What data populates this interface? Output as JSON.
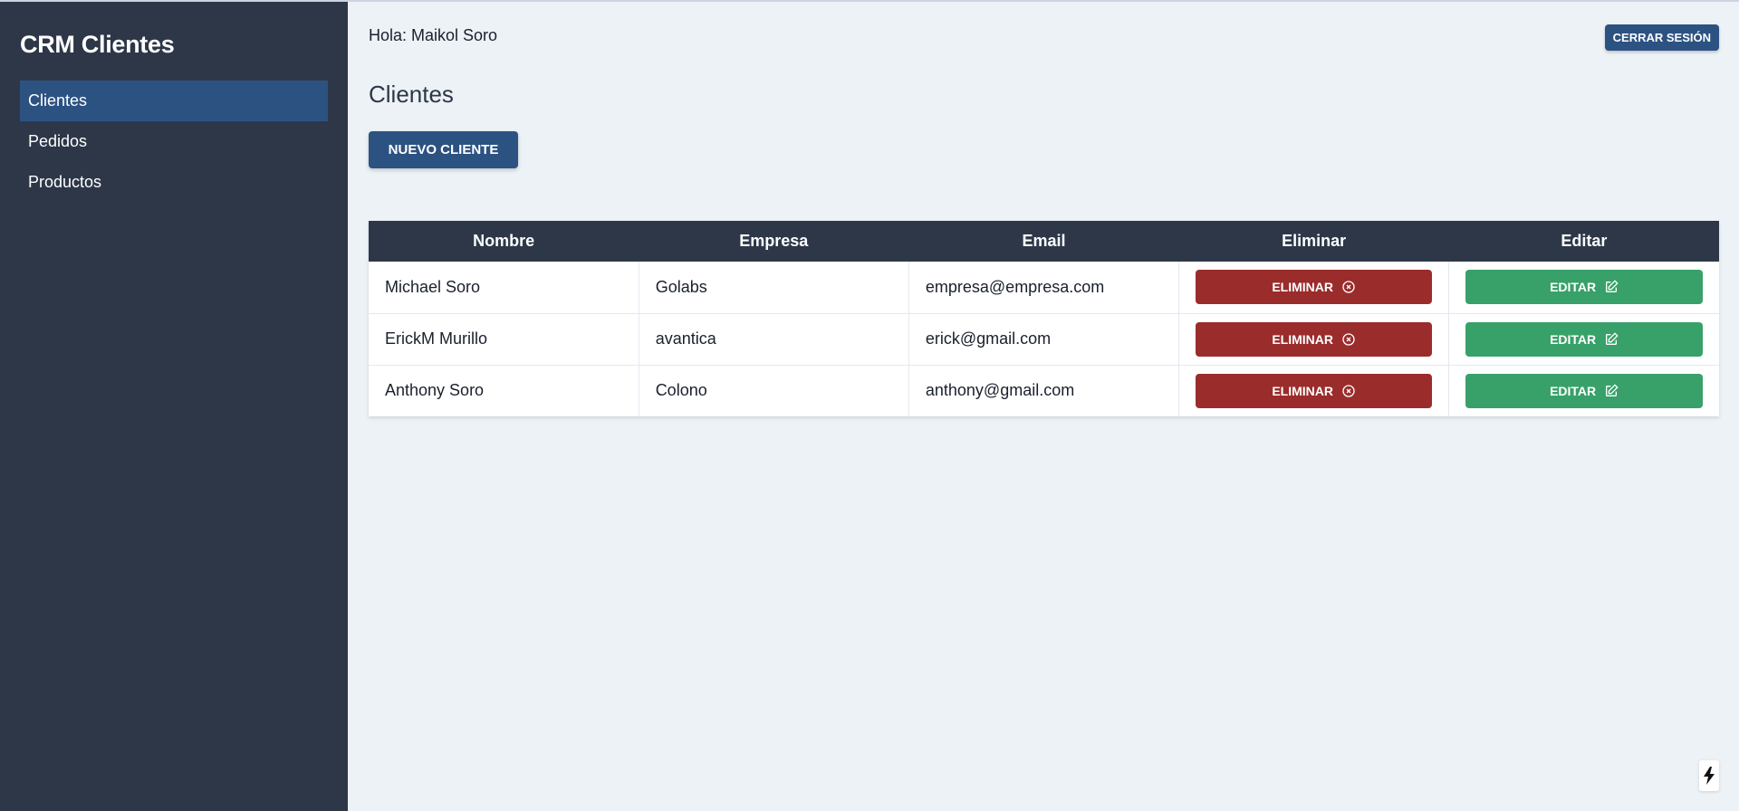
{
  "app": {
    "brand": "CRM Clientes"
  },
  "sidebar": {
    "items": [
      {
        "label": "Clientes",
        "active": true
      },
      {
        "label": "Pedidos",
        "active": false
      },
      {
        "label": "Productos",
        "active": false
      }
    ]
  },
  "header": {
    "greeting": "Hola: Maikol Soro",
    "logout_label": "CERRAR SESIÓN"
  },
  "main": {
    "title": "Clientes",
    "new_button_label": "NUEVO CLIENTE",
    "table": {
      "headers": [
        "Nombre",
        "Empresa",
        "Email",
        "Eliminar",
        "Editar"
      ],
      "rows": [
        {
          "nombre": "Michael Soro",
          "empresa": "Golabs",
          "email": "empresa@empresa.com"
        },
        {
          "nombre": "ErickM Murillo",
          "empresa": "avantica",
          "email": "erick@gmail.com"
        },
        {
          "nombre": "Anthony Soro",
          "empresa": "Colono",
          "email": "anthony@gmail.com"
        }
      ],
      "delete_label": "ELIMINAR",
      "edit_label": "EDITAR"
    }
  },
  "icons": {
    "delete": "x-circle-icon",
    "edit": "edit-icon",
    "corner": "lightning-icon"
  },
  "colors": {
    "sidebar": "#2d3748",
    "active_nav": "#2c5282",
    "primary": "#2c5282",
    "danger": "#9b2c2c",
    "success": "#38a169",
    "background": "#edf2f7"
  }
}
